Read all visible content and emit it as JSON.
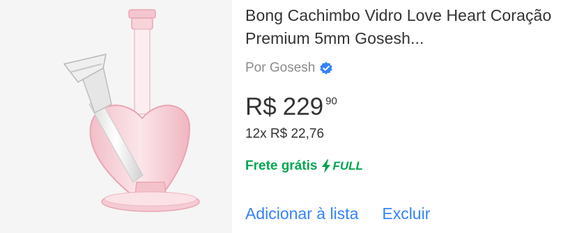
{
  "product": {
    "title": "Bong Cachimbo Vidro Love Heart Coração Premium 5mm Gosesh...",
    "seller": "Por Gosesh",
    "price": {
      "currency": "R$",
      "integer": "229",
      "cents": "90"
    },
    "installments": "12x R$ 22,76",
    "shipping": "Frete grátis",
    "full_badge": "FULL",
    "image_icon": "glass-heart-bong-image"
  },
  "actions": {
    "add_to_list": "Adicionar à lista",
    "remove": "Excluir"
  },
  "colors": {
    "title": "#333333",
    "seller": "#8c8c8c",
    "shipping": "#00a650",
    "link": "#3483fa",
    "verified": "#3483fa",
    "image_bg": "#f5f5f5"
  }
}
